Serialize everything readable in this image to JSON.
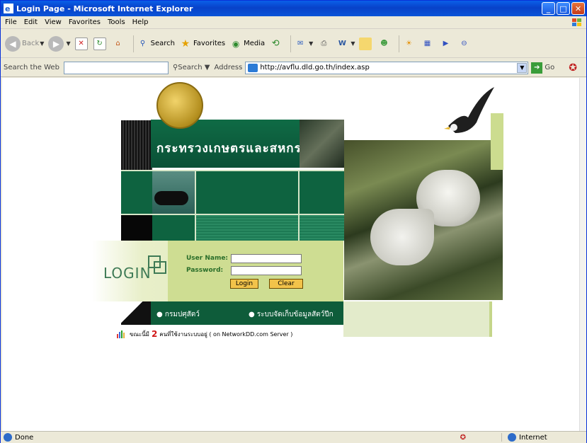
{
  "window": {
    "title": "Login Page - Microsoft Internet Explorer"
  },
  "menu": [
    "File",
    "Edit",
    "View",
    "Favorites",
    "Tools",
    "Help"
  ],
  "toolbar": {
    "back": "Back",
    "search": "Search",
    "favorites": "Favorites",
    "media": "Media"
  },
  "addressbar": {
    "search_label": "Search the Web",
    "search_button": "Search",
    "address_label": "Address",
    "url": "http://avflu.dld.go.th/index.asp",
    "go": "Go"
  },
  "page": {
    "banner_text": "กระทรวงเกษตรและสหกรณ์",
    "login_word": "LOGIN",
    "username_label": "User Name:",
    "password_label": "Password:",
    "username_value": "",
    "password_value": "",
    "login_button": "Login",
    "clear_button": "Clear",
    "nav_links": [
      "● กรมปศุสัตว์",
      "● ระบบจัดเก็บข้อมูลสัตว์ปีก"
    ],
    "footer_prefix": "ขณะนี้มี",
    "footer_count": "2",
    "footer_suffix": "คนที่ใช้งานระบบอยู่ ( on NetworkDD.com Server )"
  },
  "status": {
    "text": "Done",
    "zone": "Internet"
  }
}
